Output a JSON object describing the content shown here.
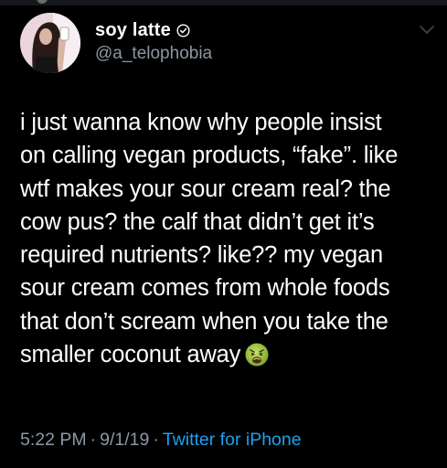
{
  "author": {
    "display_name": "soy latte",
    "handle": "@a_telophobia",
    "verified_icon": "verified-badge-icon",
    "avatar_icon": "profile-photo"
  },
  "tweet": {
    "lines": [
      "i just wanna know why people insist",
      "on calling vegan products, “fake”. like",
      "wtf makes your sour cream real? the",
      "cow pus? the calf that didn’t get it’s",
      "required nutrients? like?? my vegan",
      "sour cream comes from whole foods",
      "that don’t scream when you take the",
      "smaller coconut away"
    ],
    "emoji": "nauseated-face-icon"
  },
  "meta": {
    "time": "5:22 PM",
    "separator": "·",
    "date": "9/1/19",
    "source": "Twitter for iPhone"
  },
  "colors": {
    "background": "#000000",
    "text": "#ffffff",
    "secondary_text": "#8b98a5",
    "link": "#1da1f2"
  }
}
